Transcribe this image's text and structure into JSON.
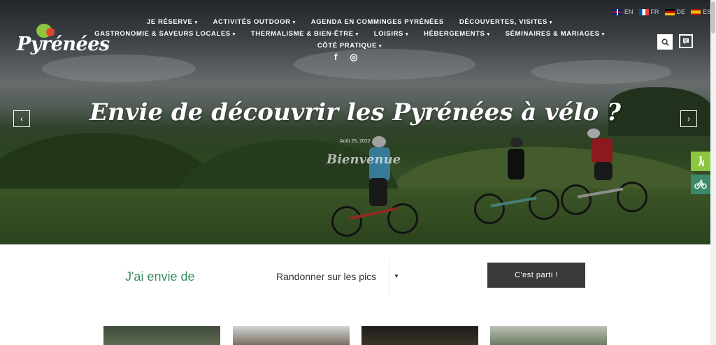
{
  "logo": {
    "text": "Pyrénées"
  },
  "nav": {
    "row1": [
      "JE RÉSERVE",
      "ACTIVITÉS OUTDOOR",
      "AGENDA EN COMMINGES PYRÉNÉES",
      "DÉCOUVERTES, VISITES"
    ],
    "row1_has_caret": [
      true,
      true,
      false,
      true
    ],
    "row2": [
      "GASTRONOMIE & SAVEURS LOCALES",
      "THERMALISME & BIEN-ÊTRE",
      "LOISIRS",
      "HÉBERGEMENTS",
      "SÉMINAIRES & MARIAGES"
    ],
    "row3": [
      "CÔTÉ PRATIQUE"
    ]
  },
  "social": {
    "facebook": "f",
    "instagram": "◎"
  },
  "languages": [
    {
      "code": "EN",
      "active": false,
      "flag": "uk"
    },
    {
      "code": "FR",
      "active": true,
      "flag": "fr"
    },
    {
      "code": "DE",
      "active": false,
      "flag": "de"
    },
    {
      "code": "ES",
      "active": false,
      "flag": "es"
    }
  ],
  "hero": {
    "headline": "Envie de découvrir les Pyrénées à vélo ?",
    "date": "Août 25, 2022",
    "category": "Bienvenue",
    "prev": "‹",
    "next": "›"
  },
  "icons": {
    "search": "search-icon",
    "chat": "chat-icon",
    "hiking": "hiking-icon",
    "bike": "bike-icon"
  },
  "colors": {
    "accent_green": "#3b8f5f",
    "tab_hiking": "#8cc63f",
    "tab_bike": "#3a8a6a",
    "button_dark": "#3a3a3a"
  },
  "finder": {
    "title": "J'ai envie de",
    "selected": "Randonner sur les pics",
    "button": "C'est parti !"
  }
}
